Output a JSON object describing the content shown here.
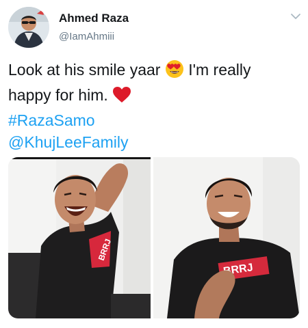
{
  "author": {
    "display_name": "Ahmed Raza",
    "handle": "@IamAhmiii"
  },
  "tweet": {
    "text_line1_before": "Look at his smile yaar",
    "text_line1_after": "I'm really",
    "text_line2": "happy for him.",
    "hashtag": "#RazaSamo",
    "mention": "@KhujLeeFamily"
  },
  "icons": {
    "avatar": "avatar",
    "menu": "chevron-down-icon",
    "emoji_1": "heart-eyes-emoji",
    "emoji_2": "red-heart-emoji"
  },
  "media": {
    "photo_left_shirt_text": "BRRJ",
    "photo_right_shirt_text": "BRRJ"
  },
  "colors": {
    "link": "#1da1f2",
    "text": "#14171a",
    "secondary": "#657786"
  }
}
